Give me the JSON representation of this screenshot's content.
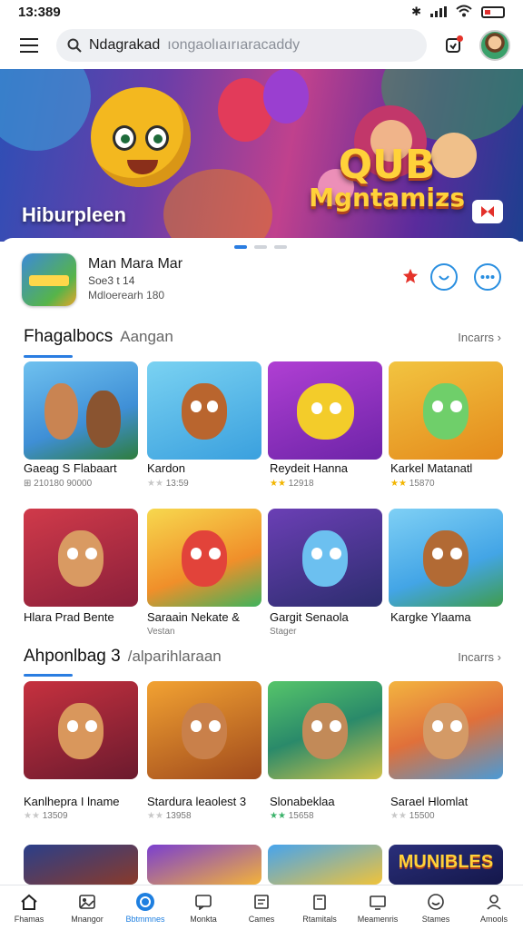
{
  "status_bar": {
    "time": "13:389"
  },
  "search": {
    "value": "Ndagrakad",
    "placeholder": "ıongaolıaırıaracaddy"
  },
  "hero": {
    "caption": "Hiburpleen",
    "logo_line1": "QUB",
    "logo_line2": "Mgntamizs"
  },
  "featured": {
    "title": "Man Mara Mar",
    "line1": "Soe3 t 14",
    "line2": "Mdloerearh 180"
  },
  "sections": [
    {
      "title": "Fhagalbocs",
      "subtitle": "Aangan",
      "more": "Incarrs",
      "games": [
        {
          "name": "Gaeag S Flabaart",
          "meta": "210180 90000",
          "stars": ""
        },
        {
          "name": "Kardon",
          "meta": "13:59",
          "stars": "★★"
        },
        {
          "name": "Reydeit Hanna",
          "meta": "12918",
          "stars": "★★"
        },
        {
          "name": "Karkel Matanatl",
          "meta": "15870",
          "stars": "★★"
        },
        {
          "name": "Hlara Prad Bente",
          "meta": "",
          "stars": ""
        },
        {
          "name": "Saraain Nekate &",
          "meta": "Vestan",
          "stars": ""
        },
        {
          "name": "Gargit Senaola",
          "meta": "Stager",
          "stars": ""
        },
        {
          "name": "Kargke Ylaama",
          "meta": "",
          "stars": ""
        }
      ]
    },
    {
      "title": "Ahponlbag 3",
      "subtitle": "/alparihlaraan",
      "more": "Incarrs",
      "games": [
        {
          "name": "Kanlhepra I lname",
          "meta": "13509",
          "stars": "★★"
        },
        {
          "name": "Stardura leaolest 3",
          "meta": "13958",
          "stars": "★★"
        },
        {
          "name": "Slonabeklaa",
          "meta": "15658",
          "stars": "★★"
        },
        {
          "name": "Sarael Hlomlat",
          "meta": "15500",
          "stars": "★★"
        }
      ]
    }
  ],
  "row4_logo": "MUNIBLES",
  "bottom_nav": [
    {
      "label": "Fhamas",
      "icon": "home-icon"
    },
    {
      "label": "Mnangor",
      "icon": "image-icon"
    },
    {
      "label": "Bbtmmnes",
      "icon": "globe-icon"
    },
    {
      "label": "Monkta",
      "icon": "chat-icon"
    },
    {
      "label": "Cames",
      "icon": "news-icon"
    },
    {
      "label": "Rtamitals",
      "icon": "book-icon"
    },
    {
      "label": "Meamenris",
      "icon": "tv-icon"
    },
    {
      "label": "Stames",
      "icon": "smile-icon"
    },
    {
      "label": "Amools",
      "icon": "person-icon"
    }
  ],
  "colors": {
    "accent": "#1e7fe0",
    "badge_red": "#e5332a",
    "star": "#f2b500"
  }
}
